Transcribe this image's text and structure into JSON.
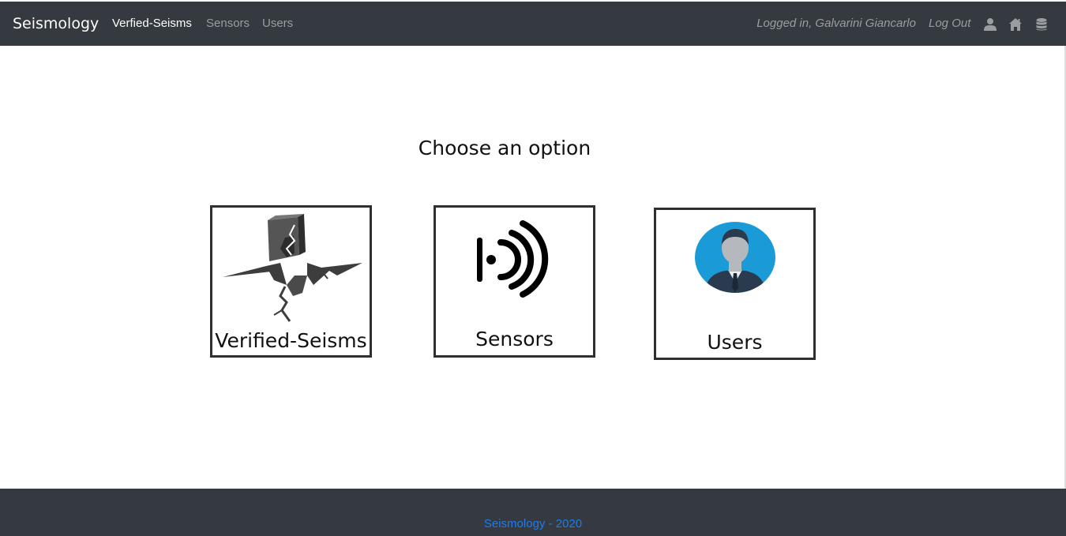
{
  "navbar": {
    "brand": "Seismology",
    "links": [
      "Verfied-Seisms",
      "Sensors",
      "Users"
    ],
    "active_link": "Verfied-Seisms",
    "logged_in_text": "Logged in, Galvarini Giancarlo",
    "logout_label": "Log Out",
    "icons": [
      "user-icon",
      "home-icon",
      "database-icon"
    ]
  },
  "main": {
    "heading": "Choose an option",
    "cards": [
      {
        "label": "Verified-Seisms",
        "icon": "earthquake-crack-icon"
      },
      {
        "label": "Sensors",
        "icon": "signal-waves-icon"
      },
      {
        "label": "Users",
        "icon": "user-avatar-icon"
      }
    ]
  },
  "footer": {
    "text": "Seismology - 2020"
  },
  "colors": {
    "navbar_bg": "#343a40",
    "nav_muted": "#9a9da1",
    "footer_link": "#1e7bf0",
    "avatar_bg": "#1a9bd7"
  }
}
